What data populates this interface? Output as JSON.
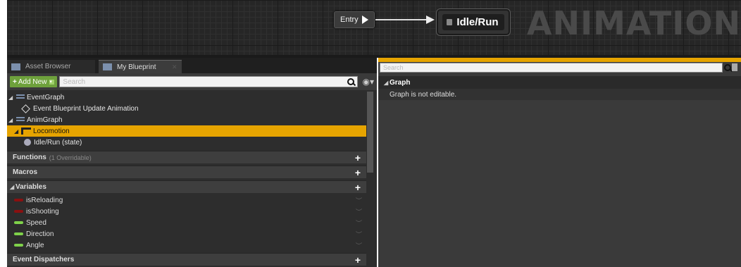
{
  "graph": {
    "entry_label": "Entry",
    "state_label": "Idle/Run",
    "watermark": "ANIMATION"
  },
  "left_panel": {
    "tabs": [
      {
        "label": "Asset Browser"
      },
      {
        "label": "My Blueprint"
      }
    ],
    "add_new_label": "Add New",
    "search_placeholder": "Search",
    "tree": {
      "event_graph": "EventGraph",
      "event_update": "Event Blueprint Update Animation",
      "anim_graph": "AnimGraph",
      "locomotion": "Locomotion",
      "idle_run_state": "Idle/Run (state)"
    },
    "sections": {
      "functions": "Functions",
      "functions_sub": "(1 Overridable)",
      "macros": "Macros",
      "variables": "Variables",
      "event_dispatchers": "Event Dispatchers"
    },
    "variables": [
      {
        "name": "isReloading",
        "color": "#8a1010"
      },
      {
        "name": "isShooting",
        "color": "#8a1010"
      },
      {
        "name": "Speed",
        "color": "#7fd24a"
      },
      {
        "name": "Direction",
        "color": "#7fd24a"
      },
      {
        "name": "Angle",
        "color": "#7fd24a"
      }
    ]
  },
  "right_panel": {
    "search_placeholder": "Search",
    "graph_header": "Graph",
    "graph_message": "Graph is not editable."
  },
  "colors": {
    "selection": "#e6a400",
    "add_button": "#6ea13c"
  }
}
